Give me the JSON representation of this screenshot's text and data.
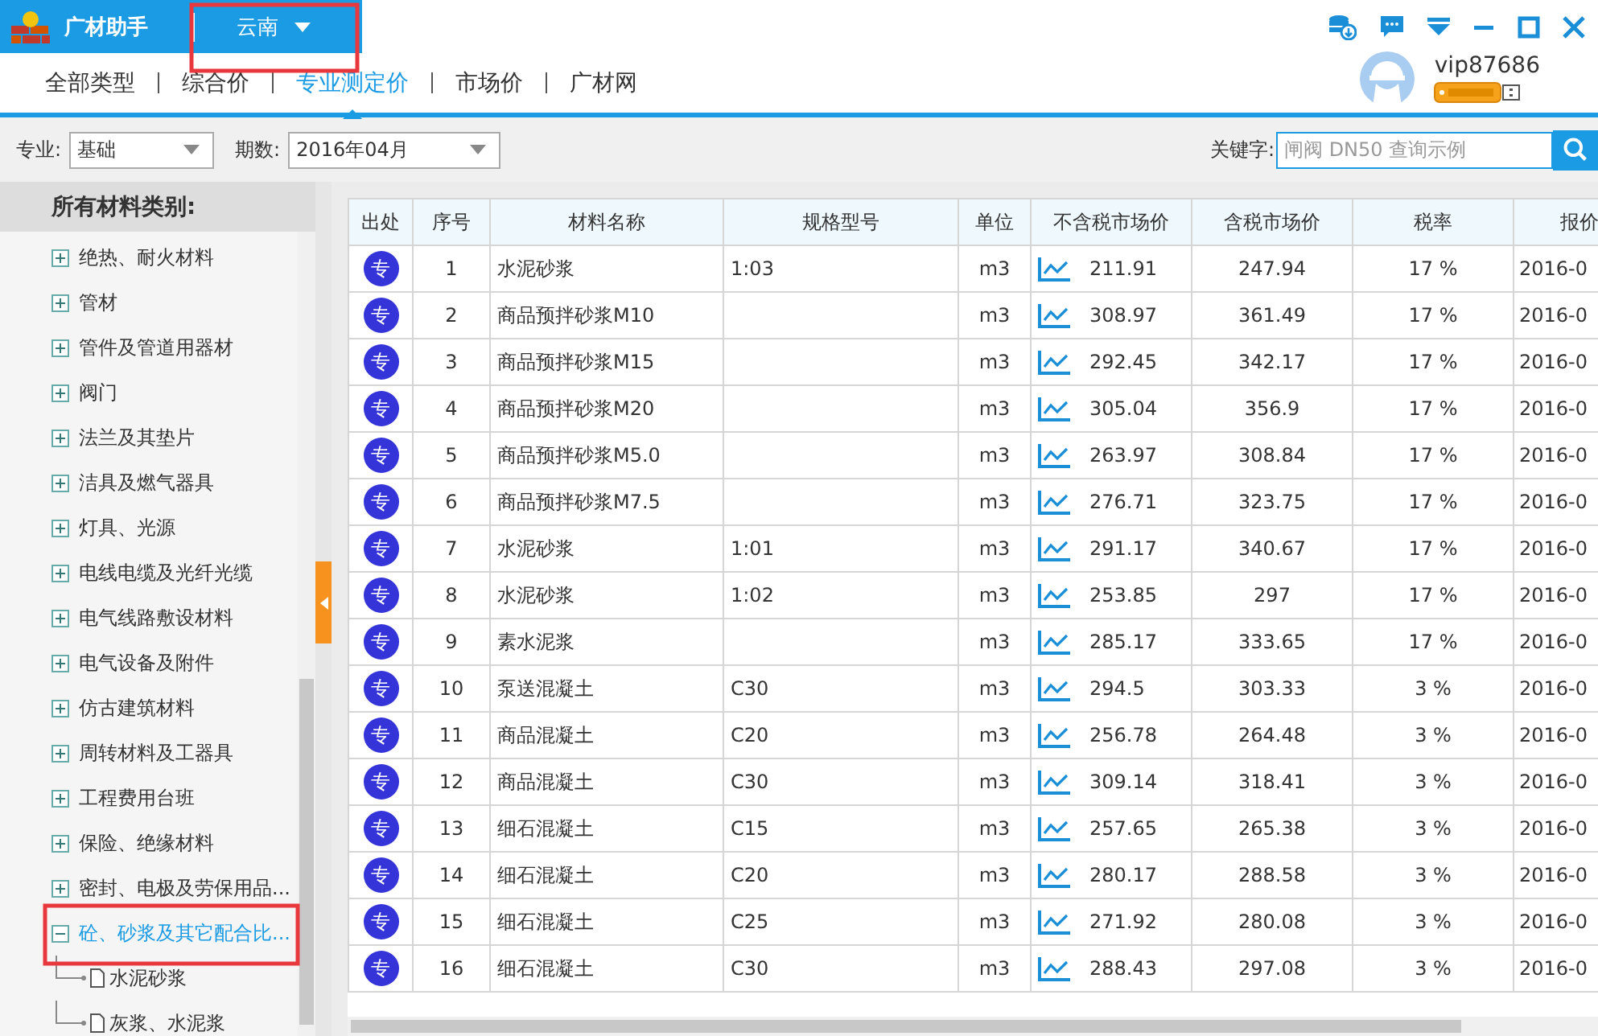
{
  "app": {
    "name": "广材助手",
    "region": "云南"
  },
  "nav_tabs": [
    {
      "label": "全部类型",
      "selected": false
    },
    {
      "label": "综合价",
      "selected": false
    },
    {
      "label": "专业测定价",
      "selected": true
    },
    {
      "label": "市场价",
      "selected": false
    },
    {
      "label": "广材网",
      "selected": false
    }
  ],
  "user": {
    "name": "vip87686"
  },
  "filters": {
    "specialty_label": "专业:",
    "specialty": "基础",
    "period_label": "期数:",
    "period": "2016年04月"
  },
  "search": {
    "label": "关键字:",
    "placeholder": "闸阀 DN50 查询示例"
  },
  "sidebar": {
    "title": "所有材料类别:",
    "items": [
      {
        "label": "绝热、耐火材料",
        "expanded": false,
        "selected": false
      },
      {
        "label": "管材",
        "expanded": false,
        "selected": false
      },
      {
        "label": "管件及管道用器材",
        "expanded": false,
        "selected": false
      },
      {
        "label": "阀门",
        "expanded": false,
        "selected": false
      },
      {
        "label": "法兰及其垫片",
        "expanded": false,
        "selected": false
      },
      {
        "label": "洁具及燃气器具",
        "expanded": false,
        "selected": false
      },
      {
        "label": "灯具、光源",
        "expanded": false,
        "selected": false
      },
      {
        "label": "电线电缆及光纤光缆",
        "expanded": false,
        "selected": false
      },
      {
        "label": "电气线路敷设材料",
        "expanded": false,
        "selected": false
      },
      {
        "label": "电气设备及附件",
        "expanded": false,
        "selected": false
      },
      {
        "label": "仿古建筑材料",
        "expanded": false,
        "selected": false
      },
      {
        "label": "周转材料及工器具",
        "expanded": false,
        "selected": false
      },
      {
        "label": "工程费用台班",
        "expanded": false,
        "selected": false
      },
      {
        "label": "保险、绝缘材料",
        "expanded": false,
        "selected": false
      },
      {
        "label": "密封、电极及劳保用品...",
        "expanded": false,
        "selected": false
      },
      {
        "label": "砼、砂浆及其它配合比...",
        "expanded": true,
        "selected": true,
        "children": [
          {
            "label": "水泥砂浆"
          },
          {
            "label": "灰浆、水泥浆"
          }
        ]
      }
    ]
  },
  "table": {
    "columns": [
      "出处",
      "序号",
      "材料名称",
      "规格型号",
      "单位",
      "不含税市场价",
      "含税市场价",
      "税率",
      "报价"
    ],
    "rows": [
      {
        "badge": "专",
        "no": "1",
        "name": "水泥砂浆",
        "spec": "1:03",
        "unit": "m3",
        "price_ex": "211.91",
        "price_inc": "247.94",
        "tax": "17 %",
        "date": "2016-0"
      },
      {
        "badge": "专",
        "no": "2",
        "name": "商品预拌砂浆M10",
        "unit": "m3",
        "price_ex": "308.97",
        "price_inc": "361.49",
        "tax": "17 %",
        "date": "2016-0"
      },
      {
        "badge": "专",
        "no": "3",
        "name": "商品预拌砂浆M15",
        "unit": "m3",
        "price_ex": "292.45",
        "price_inc": "342.17",
        "tax": "17 %",
        "date": "2016-0"
      },
      {
        "badge": "专",
        "no": "4",
        "name": "商品预拌砂浆M20",
        "unit": "m3",
        "price_ex": "305.04",
        "price_inc": "356.9",
        "tax": "17 %",
        "date": "2016-0"
      },
      {
        "badge": "专",
        "no": "5",
        "name": "商品预拌砂浆M5.0",
        "unit": "m3",
        "price_ex": "263.97",
        "price_inc": "308.84",
        "tax": "17 %",
        "date": "2016-0"
      },
      {
        "badge": "专",
        "no": "6",
        "name": "商品预拌砂浆M7.5",
        "unit": "m3",
        "price_ex": "276.71",
        "price_inc": "323.75",
        "tax": "17 %",
        "date": "2016-0"
      },
      {
        "badge": "专",
        "no": "7",
        "name": "水泥砂浆",
        "spec": "1:01",
        "unit": "m3",
        "price_ex": "291.17",
        "price_inc": "340.67",
        "tax": "17 %",
        "date": "2016-0"
      },
      {
        "badge": "专",
        "no": "8",
        "name": "水泥砂浆",
        "spec": "1:02",
        "unit": "m3",
        "price_ex": "253.85",
        "price_inc": "297",
        "tax": "17 %",
        "date": "2016-0"
      },
      {
        "badge": "专",
        "no": "9",
        "name": "素水泥浆",
        "unit": "m3",
        "price_ex": "285.17",
        "price_inc": "333.65",
        "tax": "17 %",
        "date": "2016-0"
      },
      {
        "badge": "专",
        "no": "10",
        "name": "泵送混凝土",
        "spec": "C30",
        "unit": "m3",
        "price_ex": "294.5",
        "price_inc": "303.33",
        "tax": "3 %",
        "date": "2016-0"
      },
      {
        "badge": "专",
        "no": "11",
        "name": "商品混凝土",
        "spec": "C20",
        "unit": "m3",
        "price_ex": "256.78",
        "price_inc": "264.48",
        "tax": "3 %",
        "date": "2016-0"
      },
      {
        "badge": "专",
        "no": "12",
        "name": "商品混凝土",
        "spec": "C30",
        "unit": "m3",
        "price_ex": "309.14",
        "price_inc": "318.41",
        "tax": "3 %",
        "date": "2016-0"
      },
      {
        "badge": "专",
        "no": "13",
        "name": "细石混凝土",
        "spec": "C15",
        "unit": "m3",
        "price_ex": "257.65",
        "price_inc": "265.38",
        "tax": "3 %",
        "date": "2016-0"
      },
      {
        "badge": "专",
        "no": "14",
        "name": "细石混凝土",
        "spec": "C20",
        "unit": "m3",
        "price_ex": "280.17",
        "price_inc": "288.58",
        "tax": "3 %",
        "date": "2016-0"
      },
      {
        "badge": "专",
        "no": "15",
        "name": "细石混凝土",
        "spec": "C25",
        "unit": "m3",
        "price_ex": "271.92",
        "price_inc": "280.08",
        "tax": "3 %",
        "date": "2016-0"
      },
      {
        "badge": "专",
        "no": "16",
        "name": "细石混凝土",
        "spec": "C30",
        "unit": "m3",
        "price_ex": "288.43",
        "price_inc": "297.08",
        "tax": "3 %",
        "date": "2016-0"
      }
    ]
  }
}
